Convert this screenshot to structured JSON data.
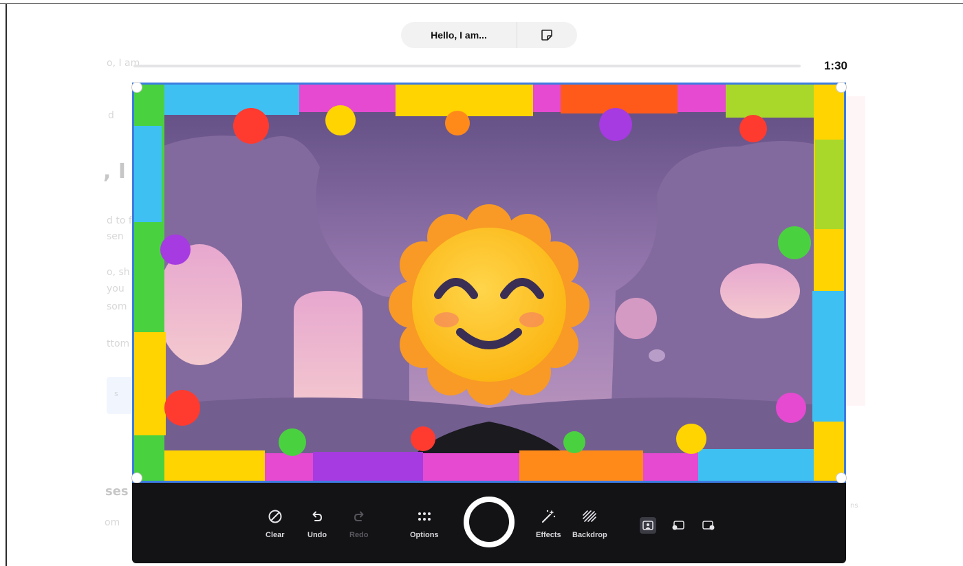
{
  "prompt": {
    "title": "Hello, I am...",
    "duration": "1:30",
    "progress_percent": 0
  },
  "toolbar": {
    "tools": [
      {
        "id": "clear",
        "label": "Clear",
        "icon": "clear-icon",
        "enabled": true
      },
      {
        "id": "undo",
        "label": "Undo",
        "icon": "undo-icon",
        "enabled": true
      },
      {
        "id": "redo",
        "label": "Redo",
        "icon": "redo-icon",
        "enabled": false
      },
      {
        "id": "options",
        "label": "Options",
        "icon": "options-icon",
        "enabled": true
      },
      {
        "id": "effects",
        "label": "Effects",
        "icon": "effects-icon",
        "enabled": true
      },
      {
        "id": "backdrop",
        "label": "Backdrop",
        "icon": "backdrop-icon",
        "enabled": true
      }
    ],
    "layouts": [
      {
        "id": "camera-full",
        "icon": "layout-camera-full-icon",
        "active": true
      },
      {
        "id": "camera-left",
        "icon": "layout-camera-left-icon",
        "active": false
      },
      {
        "id": "camera-right",
        "icon": "layout-camera-right-icon",
        "active": false
      }
    ]
  },
  "background_page": {
    "fragments": [
      "o, I am",
      "d",
      ", I",
      "d to f",
      "sen",
      "o, sh",
      "you",
      "som",
      "ttom",
      "s",
      "ses",
      "om",
      "ns"
    ]
  },
  "colors": {
    "accent": "#3d7be0",
    "toolbar_bg": "#131316",
    "pill_bg": "#f2f2f3"
  }
}
